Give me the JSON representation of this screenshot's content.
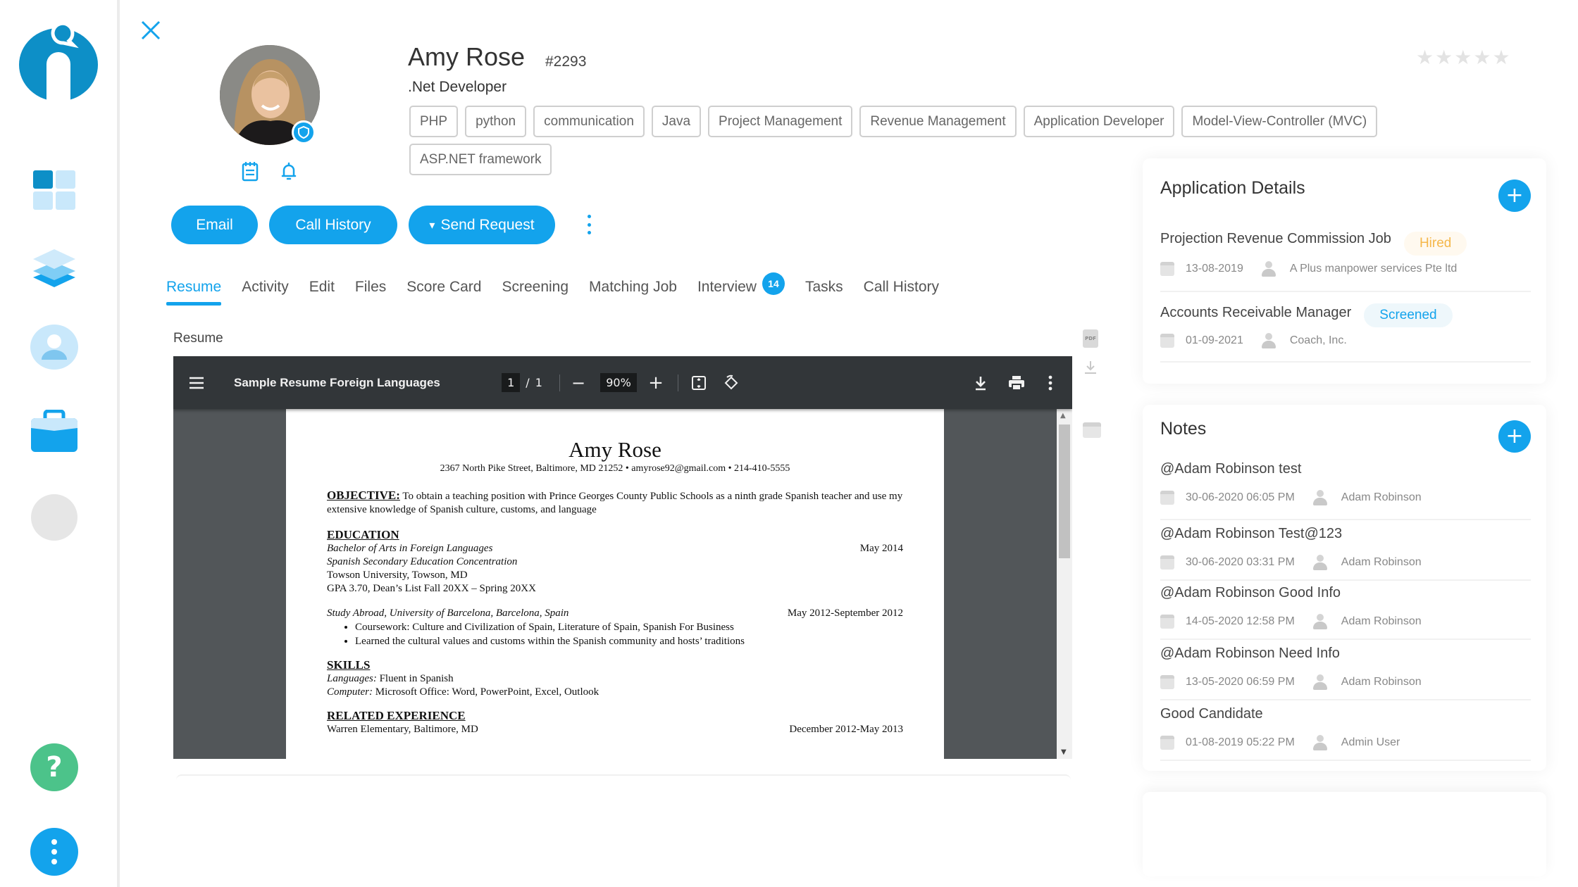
{
  "sidebar": {
    "logo": "brand-logo",
    "items": [
      {
        "icon": "dashboard-grid-icon",
        "label": "Dashboard"
      },
      {
        "icon": "layers-icon",
        "label": "Layers"
      },
      {
        "icon": "user-icon",
        "label": "Candidates"
      },
      {
        "icon": "briefcase-icon",
        "label": "Jobs"
      },
      {
        "icon": "placeholder-circle-icon",
        "label": ""
      }
    ],
    "help_icon": "?",
    "more_icon": "more-vertical-icon"
  },
  "candidate": {
    "name": "Amy Rose",
    "id": "#2293",
    "title": ".Net Developer",
    "rating": 0,
    "rating_max": 5,
    "tags": [
      "PHP",
      "python",
      "communication",
      "Java",
      "Project Management",
      "Revenue Management",
      "Application Developer",
      "Model-View-Controller (MVC)",
      "ASP.NET framework"
    ]
  },
  "actions": {
    "email": "Email",
    "call_history": "Call History",
    "send_request": "Send Request",
    "send_request_caret": "▾"
  },
  "tabs": [
    {
      "label": "Resume",
      "active": true
    },
    {
      "label": "Activity"
    },
    {
      "label": "Edit"
    },
    {
      "label": "Files"
    },
    {
      "label": "Score Card"
    },
    {
      "label": "Screening"
    },
    {
      "label": "Matching Job"
    },
    {
      "label": "Interview",
      "badge": "14"
    },
    {
      "label": "Tasks"
    },
    {
      "label": "Call History"
    }
  ],
  "resume": {
    "section_label": "Resume",
    "viewer": {
      "file_title": "Sample Resume Foreign Languages",
      "page_current": "1",
      "page_separator": "/",
      "page_total": "1",
      "zoom": "90%",
      "zoom_out": "−",
      "zoom_in": "+"
    },
    "document": {
      "name": "Amy Rose",
      "contact": "2367 North Pike Street, Baltimore, MD 21252 • amyrose92@gmail.com • 214-410-5555",
      "objective_heading": "OBJECTIVE:",
      "objective_text": " To obtain a teaching position with Prince Georges County Public Schools as a ninth grade Spanish teacher and use my extensive knowledge of Spanish culture, customs, and language",
      "education_heading": "EDUCATION",
      "degree": "Bachelor of Arts in Foreign Languages",
      "degree_date": "May 2014",
      "concentration": "Spanish Secondary Education Concentration",
      "university": "Towson University, Towson, MD",
      "gpa": "GPA 3.70, Dean’s List Fall 20XX – Spring 20XX",
      "abroad": "Study Abroad, University of Barcelona, Barcelona, Spain",
      "abroad_date": "May 2012-September 2012",
      "abroad_bullets": [
        "Coursework: Culture and Civilization of Spain, Literature of Spain, Spanish For Business",
        "Learned the cultural values and customs within the Spanish community and hosts’ traditions"
      ],
      "skills_heading": "SKILLS",
      "languages_label": "Languages:",
      "languages_value": " Fluent in Spanish",
      "computer_label": "Computer:",
      "computer_value": " Microsoft Office: Word, PowerPoint, Excel, Outlook",
      "experience_heading": "RELATED EXPERIENCE",
      "experience_place": "Warren Elementary, Baltimore, MD",
      "experience_date": "December 2012-May 2013"
    },
    "side_tools": {
      "pdf_label": "PDF"
    }
  },
  "application_details": {
    "title": "Application Details",
    "add": "+",
    "items": [
      {
        "job": "Projection Revenue Commission Job",
        "status": "Hired",
        "status_type": "hired",
        "date": "13-08-2019",
        "company": "A Plus manpower services Pte ltd"
      },
      {
        "job": "Accounts Receivable Manager",
        "status": "Screened",
        "status_type": "screened",
        "date": "01-09-2021",
        "company": "Coach, Inc."
      }
    ]
  },
  "notes": {
    "title": "Notes",
    "add": "+",
    "items": [
      {
        "text": "@Adam Robinson test",
        "datetime": "30-06-2020 06:05 PM",
        "author": "Adam Robinson"
      },
      {
        "text": "@Adam Robinson Test@123",
        "datetime": "30-06-2020 03:31 PM",
        "author": "Adam Robinson"
      },
      {
        "text": "@Adam Robinson Good Info",
        "datetime": "14-05-2020 12:58 PM",
        "author": "Adam Robinson"
      },
      {
        "text": "@Adam Robinson Need Info",
        "datetime": "13-05-2020 06:59 PM",
        "author": "Adam Robinson"
      },
      {
        "text": "Good Candidate",
        "datetime": "01-08-2019 05:22 PM",
        "author": "Admin User"
      }
    ]
  },
  "colors": {
    "accent": "#13a3ec",
    "help": "#4cc38a",
    "hired": "#f5b74a",
    "screened": "#13a3ec",
    "pdf_toolbar": "#323639",
    "pdf_bg": "#525659"
  }
}
